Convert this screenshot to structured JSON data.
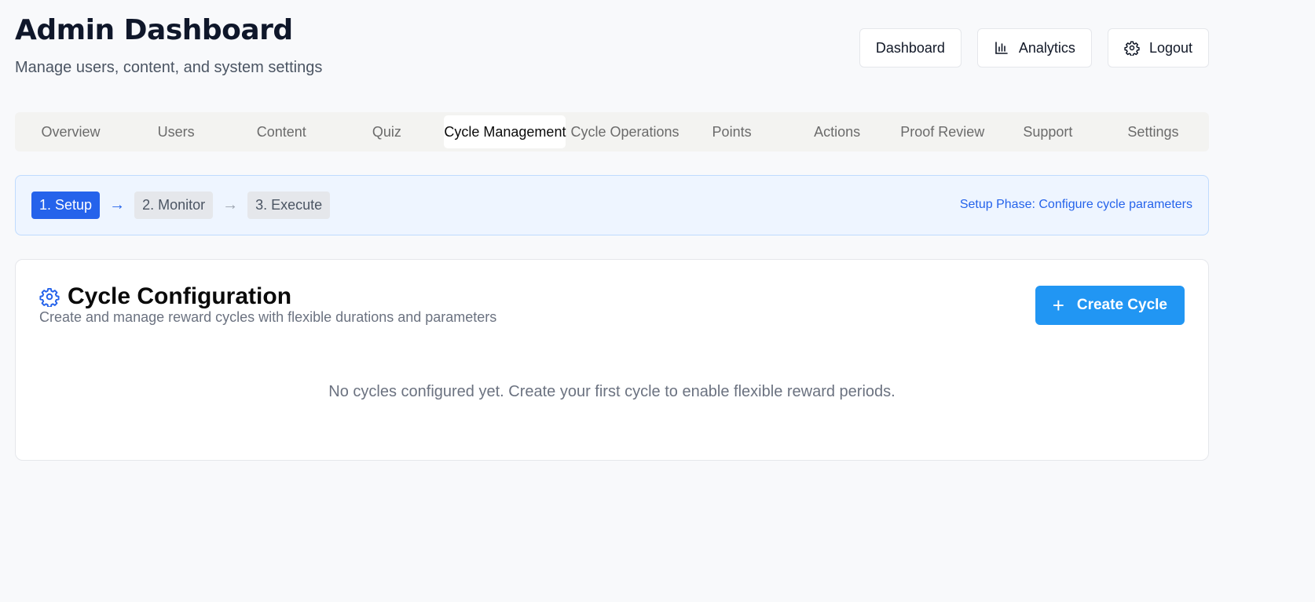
{
  "header": {
    "title": "Admin Dashboard",
    "subtitle": "Manage users, content, and system settings",
    "actions": {
      "dashboard_label": "Dashboard",
      "analytics_label": "Analytics",
      "logout_label": "Logout"
    }
  },
  "tabs": [
    {
      "label": "Overview"
    },
    {
      "label": "Users"
    },
    {
      "label": "Content"
    },
    {
      "label": "Quiz"
    },
    {
      "label": "Cycle Management",
      "active": true
    },
    {
      "label": "Cycle Operations"
    },
    {
      "label": "Points"
    },
    {
      "label": "Actions"
    },
    {
      "label": "Proof Review"
    },
    {
      "label": "Support"
    },
    {
      "label": "Settings"
    }
  ],
  "phase": {
    "steps": [
      {
        "label": "1. Setup",
        "active": true
      },
      {
        "label": "2. Monitor"
      },
      {
        "label": "3. Execute"
      }
    ],
    "arrow": "→",
    "note": "Setup Phase: Configure cycle parameters"
  },
  "card": {
    "icon": "gear-icon",
    "title": "Cycle Configuration",
    "description": "Create and manage reward cycles with flexible durations and parameters",
    "create_button": {
      "icon": "plus-icon",
      "label": "Create Cycle"
    },
    "empty_message": "No cycles configured yet. Create your first cycle to enable flexible reward periods."
  },
  "colors": {
    "accent": "#2563eb",
    "button_blue": "#2196f3",
    "banner_bg": "#eef5ff"
  }
}
